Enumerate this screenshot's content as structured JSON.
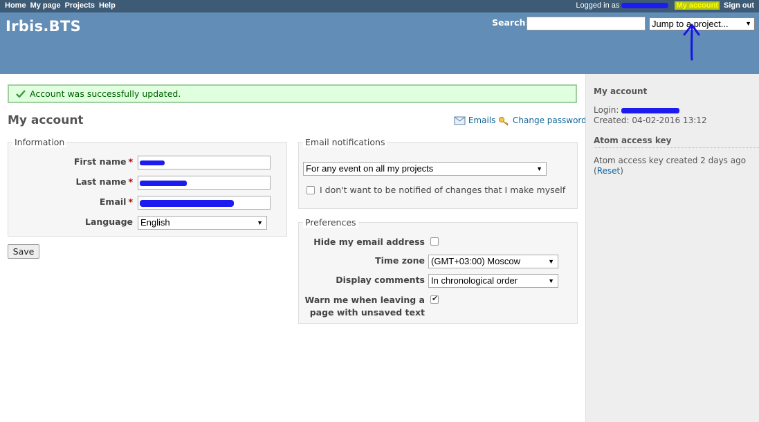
{
  "top_menu": {
    "items": [
      "Home",
      "My page",
      "Projects",
      "Help"
    ],
    "logged_in_label": "Logged in as",
    "my_account": "My account",
    "sign_out": "Sign out"
  },
  "header": {
    "title": "Irbis.BTS",
    "search_label": "Search:",
    "jump_label": "Jump to a project..."
  },
  "flash": "Account was successfully updated.",
  "page_title": "My account",
  "contextual": {
    "emails": "Emails",
    "change_password": "Change password"
  },
  "information": {
    "legend": "Information",
    "first_name_label": "First name",
    "last_name_label": "Last name",
    "email_label": "Email",
    "language_label": "Language",
    "language_value": "English",
    "required_mark": "*"
  },
  "save_label": "Save",
  "email_notifications": {
    "legend": "Email notifications",
    "select_value": "For any event on all my projects",
    "no_self_notified": "I don't want to be notified of changes that I make myself",
    "no_self_notified_checked": false
  },
  "preferences": {
    "legend": "Preferences",
    "hide_mail_label": "Hide my email address",
    "hide_mail_checked": false,
    "time_zone_label": "Time zone",
    "time_zone_value": "(GMT+03:00) Moscow",
    "comments_label": "Display comments",
    "comments_value": "In chronological order",
    "warn_label_1": "Warn me when leaving a",
    "warn_label_2": "page with unsaved text",
    "warn_checked": true
  },
  "sidebar": {
    "title": "My account",
    "login_label": "Login:",
    "created_label": "Created:",
    "created_value": "04-02-2016 13:12",
    "atom_title": "Atom access key",
    "atom_text": "Atom access key created 2 days ago",
    "reset_label": "Reset",
    "paren_open": "(",
    "paren_close": ")"
  },
  "colors": {
    "header_bg": "#628db6",
    "top_menu_bg": "#3e5b76",
    "flash_bg": "#dfffdf",
    "link": "#116699",
    "sidebar_bg": "#eeeeee"
  }
}
